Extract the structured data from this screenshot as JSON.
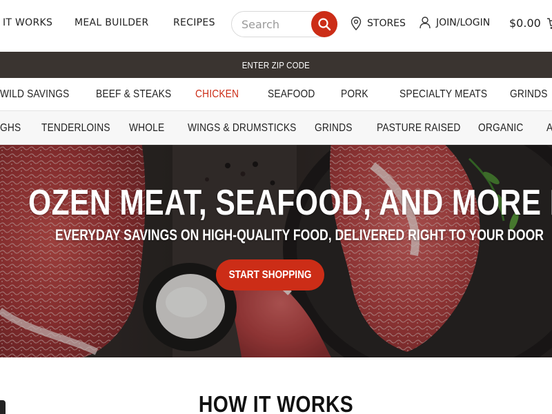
{
  "header": {
    "nav": [
      "IT WORKS",
      "MEAL BUILDER",
      "RECIPES"
    ],
    "search_placeholder": "Search",
    "stores_label": "STORES",
    "login_label": "JOIN/LOGIN",
    "cart_total": "$0.00",
    "icons": {
      "search": "search-icon",
      "stores": "map-pin-icon",
      "login": "user-icon",
      "cart": "cart-icon"
    },
    "accent_color": "#cc2d17"
  },
  "zip_bar": {
    "label": "ENTER ZIP CODE",
    "background": "#3a3430"
  },
  "categories": {
    "primary": [
      "WILD SAVINGS",
      "BEEF & STEAKS",
      "CHICKEN",
      "SEAFOOD",
      "PORK",
      "SPECIALTY MEATS",
      "GRINDS"
    ],
    "active": "CHICKEN",
    "secondary": [
      "GHS",
      "TENDERLOINS",
      "WHOLE",
      "WINGS & DRUMSTICKS",
      "GRINDS",
      "PASTURE RAISED",
      "ORGANIC",
      "A"
    ]
  },
  "hero": {
    "title": "OZEN MEAT, SEAFOOD, AND MORE FOR LES",
    "subtitle": "EVERYDAY SAVINGS ON HIGH-QUALITY FOOD, DELIVERED RIGHT TO YOUR DOOR",
    "cta_label": "START SHOPPING"
  },
  "how_it_works": {
    "title": "HOW IT WORKS"
  }
}
